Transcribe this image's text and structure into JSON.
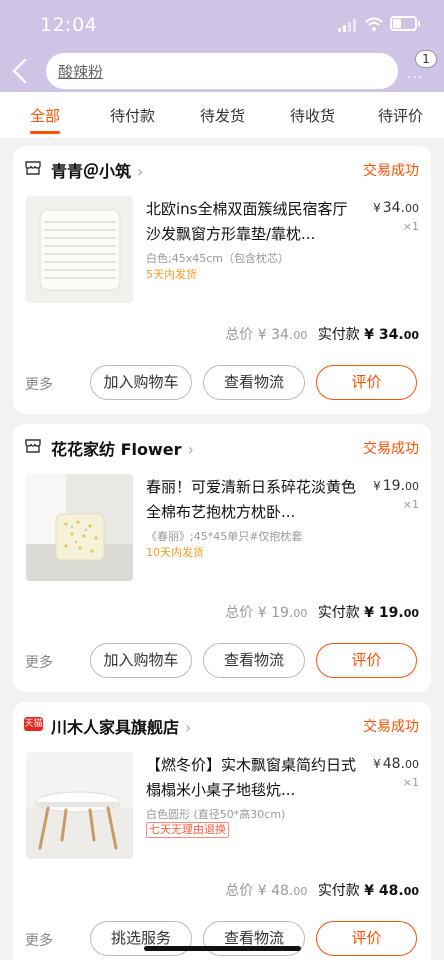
{
  "status_bar": {
    "time": "12:04"
  },
  "header": {
    "search_text": "酸辣粉",
    "more_dots": "···",
    "badge_count": "1"
  },
  "tabs": [
    {
      "label": "全部",
      "active": true
    },
    {
      "label": "待付款"
    },
    {
      "label": "待发货"
    },
    {
      "label": "待收货"
    },
    {
      "label": "待评价"
    }
  ],
  "orders": [
    {
      "shop_name": "青青＠小筑",
      "shop_icon": "store-icon",
      "status": "交易成功",
      "title": "北欧ins全棉双面簇绒民宿客厅沙发飘窗方形靠垫/靠枕...",
      "price_currency": "¥",
      "price_int": "34.",
      "price_dec": "00",
      "qty": "×1",
      "spec": "白色;45x45cm（包含枕芯）",
      "shipping": "5天内发货",
      "total_label": "总价",
      "total_value": "¥ 34.",
      "total_dec": "00",
      "paid_label": "实付款",
      "paid_value": "¥ 34.",
      "paid_dec": "00",
      "more": "更多",
      "btn1": "加入购物车",
      "btn2": "查看物流",
      "btn3": "评价"
    },
    {
      "shop_name": "花花家纺 Flower",
      "shop_icon": "store-icon",
      "status": "交易成功",
      "title": "春丽！可爱清新日系碎花淡黄色全棉布艺抱枕方枕卧...",
      "price_currency": "¥",
      "price_int": "19.",
      "price_dec": "00",
      "qty": "×1",
      "spec": "《春丽》;45*45单只#仅抱枕套",
      "shipping": "10天内发货",
      "total_label": "总价",
      "total_value": "¥ 19.",
      "total_dec": "00",
      "paid_label": "实付款",
      "paid_value": "¥ 19.",
      "paid_dec": "00",
      "more": "更多",
      "btn1": "加入购物车",
      "btn2": "查看物流",
      "btn3": "评价"
    },
    {
      "shop_name": "川木人家具旗舰店",
      "shop_icon_text": "天猫",
      "status": "交易成功",
      "title": "【燃冬价】实木飘窗桌简约日式榻榻米小桌子地毯炕...",
      "price_currency": "¥",
      "price_int": "48.",
      "price_dec": "00",
      "qty": "×1",
      "spec": "白色圆形 (直径50*高30cm)",
      "shipping": "七天无理由退换",
      "total_label": "总价",
      "total_value": "¥ 48.",
      "total_dec": "00",
      "paid_label": "实付款",
      "paid_value": "¥ 48.",
      "paid_dec": "00",
      "more": "更多",
      "btn1": "挑选服务",
      "btn2": "查看物流",
      "btn3": "评价"
    }
  ],
  "colors": {
    "accent": "#ff5000",
    "header_bg": "#cfc3e6"
  }
}
